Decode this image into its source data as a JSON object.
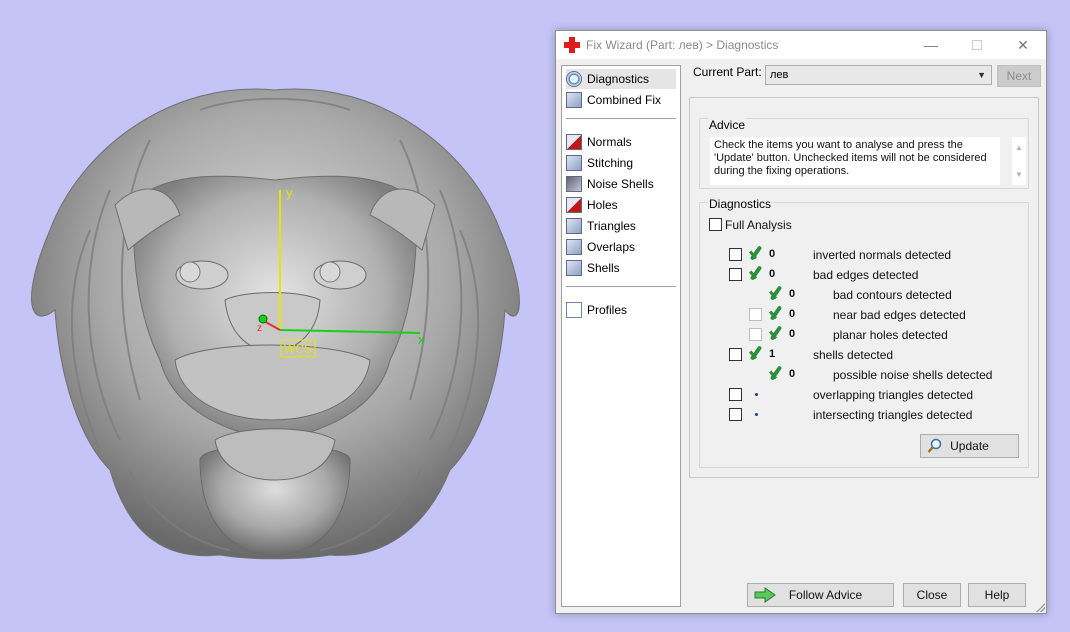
{
  "window": {
    "title": "Fix Wizard (Part: лев) > Diagnostics",
    "minimize_glyph": "—",
    "close_glyph": "✕"
  },
  "viewport": {
    "axis_y": "y",
    "axis_x": "x",
    "axis_z": "z",
    "wcs_label": "WCS"
  },
  "nav": {
    "items": [
      {
        "label": "Diagnostics",
        "icon": "magnifier-icon"
      },
      {
        "label": "Combined Fix",
        "icon": "combined-fix-icon"
      },
      {
        "label": "Normals",
        "icon": "normals-icon"
      },
      {
        "label": "Stitching",
        "icon": "stitching-icon"
      },
      {
        "label": "Noise Shells",
        "icon": "noise-shells-icon"
      },
      {
        "label": "Holes",
        "icon": "holes-icon"
      },
      {
        "label": "Triangles",
        "icon": "triangles-icon"
      },
      {
        "label": "Overlaps",
        "icon": "overlaps-icon"
      },
      {
        "label": "Shells",
        "icon": "shells-icon"
      },
      {
        "label": "Profiles",
        "icon": "document-icon"
      }
    ]
  },
  "current_part": {
    "label": "Current Part:",
    "value": "лев",
    "next_label": "Next"
  },
  "advice": {
    "title": "Advice",
    "text": "Check the items you want to analyse and press the 'Update' button. Unchecked items will not be considered during the fixing operations.",
    "scroll_up": "▲",
    "scroll_down": "▼"
  },
  "diagnostics": {
    "title": "Diagnostics",
    "full_analysis": "Full Analysis",
    "rows": [
      {
        "count": "0",
        "label": "inverted normals detected"
      },
      {
        "count": "0",
        "label": "bad edges detected"
      },
      {
        "count": "0",
        "label": "bad contours detected"
      },
      {
        "count": "0",
        "label": "near bad edges detected"
      },
      {
        "count": "0",
        "label": "planar holes detected"
      },
      {
        "count": "1",
        "label": "shells detected"
      },
      {
        "count": "0",
        "label": "possible noise shells detected"
      },
      {
        "count": "",
        "label": "overlapping triangles detected"
      },
      {
        "count": "",
        "label": "intersecting triangles detected"
      }
    ],
    "update_label": "Update"
  },
  "footer": {
    "follow_advice": "Follow Advice",
    "close": "Close",
    "help": "Help"
  },
  "colors": {
    "background": "#c4c4f6",
    "check_green": "#2d8f3a",
    "brand_red": "#e01b1b"
  }
}
